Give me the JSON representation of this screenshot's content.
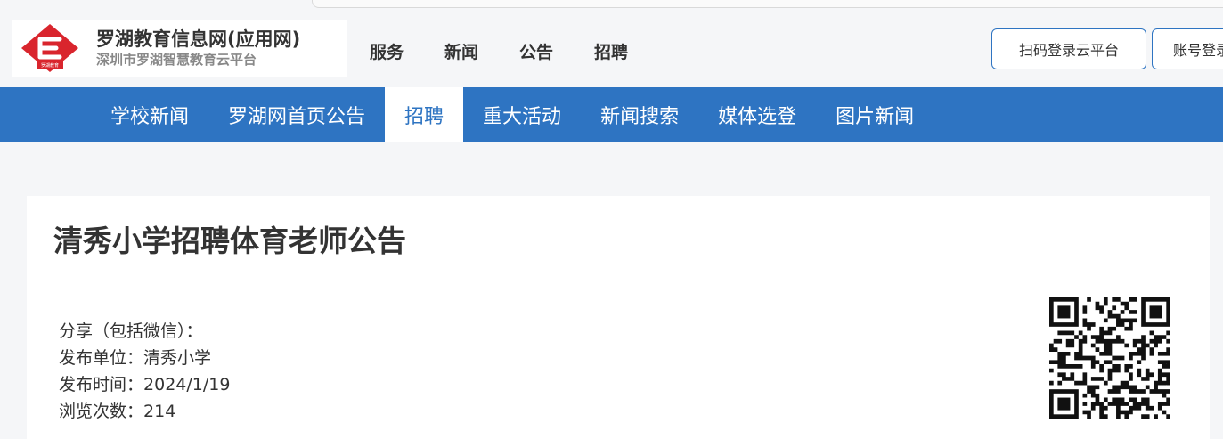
{
  "header": {
    "logo_badge_text": "罗湖教育",
    "logo_title": "罗湖教育信息网(应用网)",
    "logo_subtitle": "深圳市罗湖智慧教育云平台",
    "nav": [
      "服务",
      "新闻",
      "公告",
      "招聘"
    ],
    "qr_login_label": "扫码登录云平台",
    "account_login_label": "账号登录"
  },
  "subnav": {
    "items": [
      "学校新闻",
      "罗湖网首页公告",
      "招聘",
      "重大活动",
      "新闻搜索",
      "媒体选登",
      "图片新闻"
    ],
    "active": "招聘"
  },
  "article": {
    "title": "清秀小学招聘体育老师公告",
    "share_label": "分享（包括微信）：",
    "publisher_label": "发布单位：",
    "publisher": "清秀小学",
    "date_label": "发布时间：",
    "date": "2024/1/19",
    "views_label": "浏览次数：",
    "views": "214"
  },
  "colors": {
    "brand_blue": "#2e74c2",
    "logo_red": "#d9252d"
  },
  "icons": {
    "logo": "luohu-education-logo-icon",
    "qr": "qr-code-icon"
  }
}
